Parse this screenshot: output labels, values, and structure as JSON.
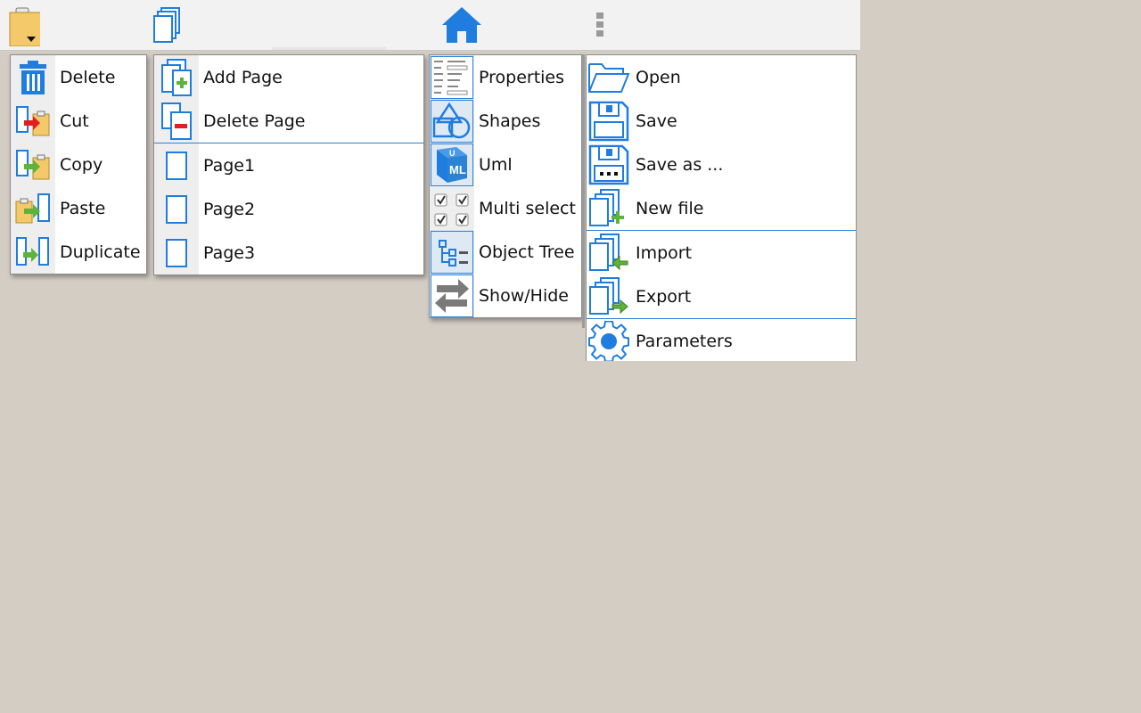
{
  "colors": {
    "accent": "#2b83d6",
    "background": "#d4cdc4",
    "toolbar": "#f2f2f2"
  },
  "toolbar": {
    "items": [
      {
        "icon": "clipboard-dropdown-icon"
      },
      {
        "icon": "pages-icon"
      },
      {
        "icon": "home-icon"
      },
      {
        "icon": "overflow-menu-icon"
      }
    ]
  },
  "menus": {
    "edit": {
      "items": [
        {
          "label": "Delete",
          "icon": "trash-icon"
        },
        {
          "label": "Cut",
          "icon": "cut-icon"
        },
        {
          "label": "Copy",
          "icon": "copy-icon"
        },
        {
          "label": "Paste",
          "icon": "paste-icon"
        },
        {
          "label": "Duplicate",
          "icon": "duplicate-icon"
        }
      ]
    },
    "pages": {
      "actions": [
        {
          "label": "Add Page",
          "icon": "add-page-icon"
        },
        {
          "label": "Delete Page",
          "icon": "delete-page-icon"
        }
      ],
      "pages": [
        {
          "label": "Page1",
          "icon": "page-icon"
        },
        {
          "label": "Page2",
          "icon": "page-icon"
        },
        {
          "label": "Page3",
          "icon": "page-icon"
        }
      ]
    },
    "view": {
      "items": [
        {
          "label": "Properties",
          "icon": "properties-icon"
        },
        {
          "label": "Shapes",
          "icon": "shapes-icon"
        },
        {
          "label": "Uml",
          "icon": "uml-icon"
        },
        {
          "label": "Multi select",
          "icon": "multi-select-icon"
        },
        {
          "label": "Object Tree",
          "icon": "object-tree-icon"
        },
        {
          "label": "Show/Hide",
          "icon": "show-hide-icon"
        }
      ]
    },
    "file": {
      "group1": [
        {
          "label": "Open",
          "icon": "folder-open-icon"
        },
        {
          "label": "Save",
          "icon": "save-icon"
        },
        {
          "label": "Save as ...",
          "icon": "save-as-icon"
        },
        {
          "label": "New file",
          "icon": "new-file-icon"
        }
      ],
      "group2": [
        {
          "label": "Import",
          "icon": "import-icon"
        },
        {
          "label": "Export",
          "icon": "export-icon"
        }
      ],
      "group3": [
        {
          "label": "Parameters",
          "icon": "gear-icon"
        }
      ]
    }
  }
}
